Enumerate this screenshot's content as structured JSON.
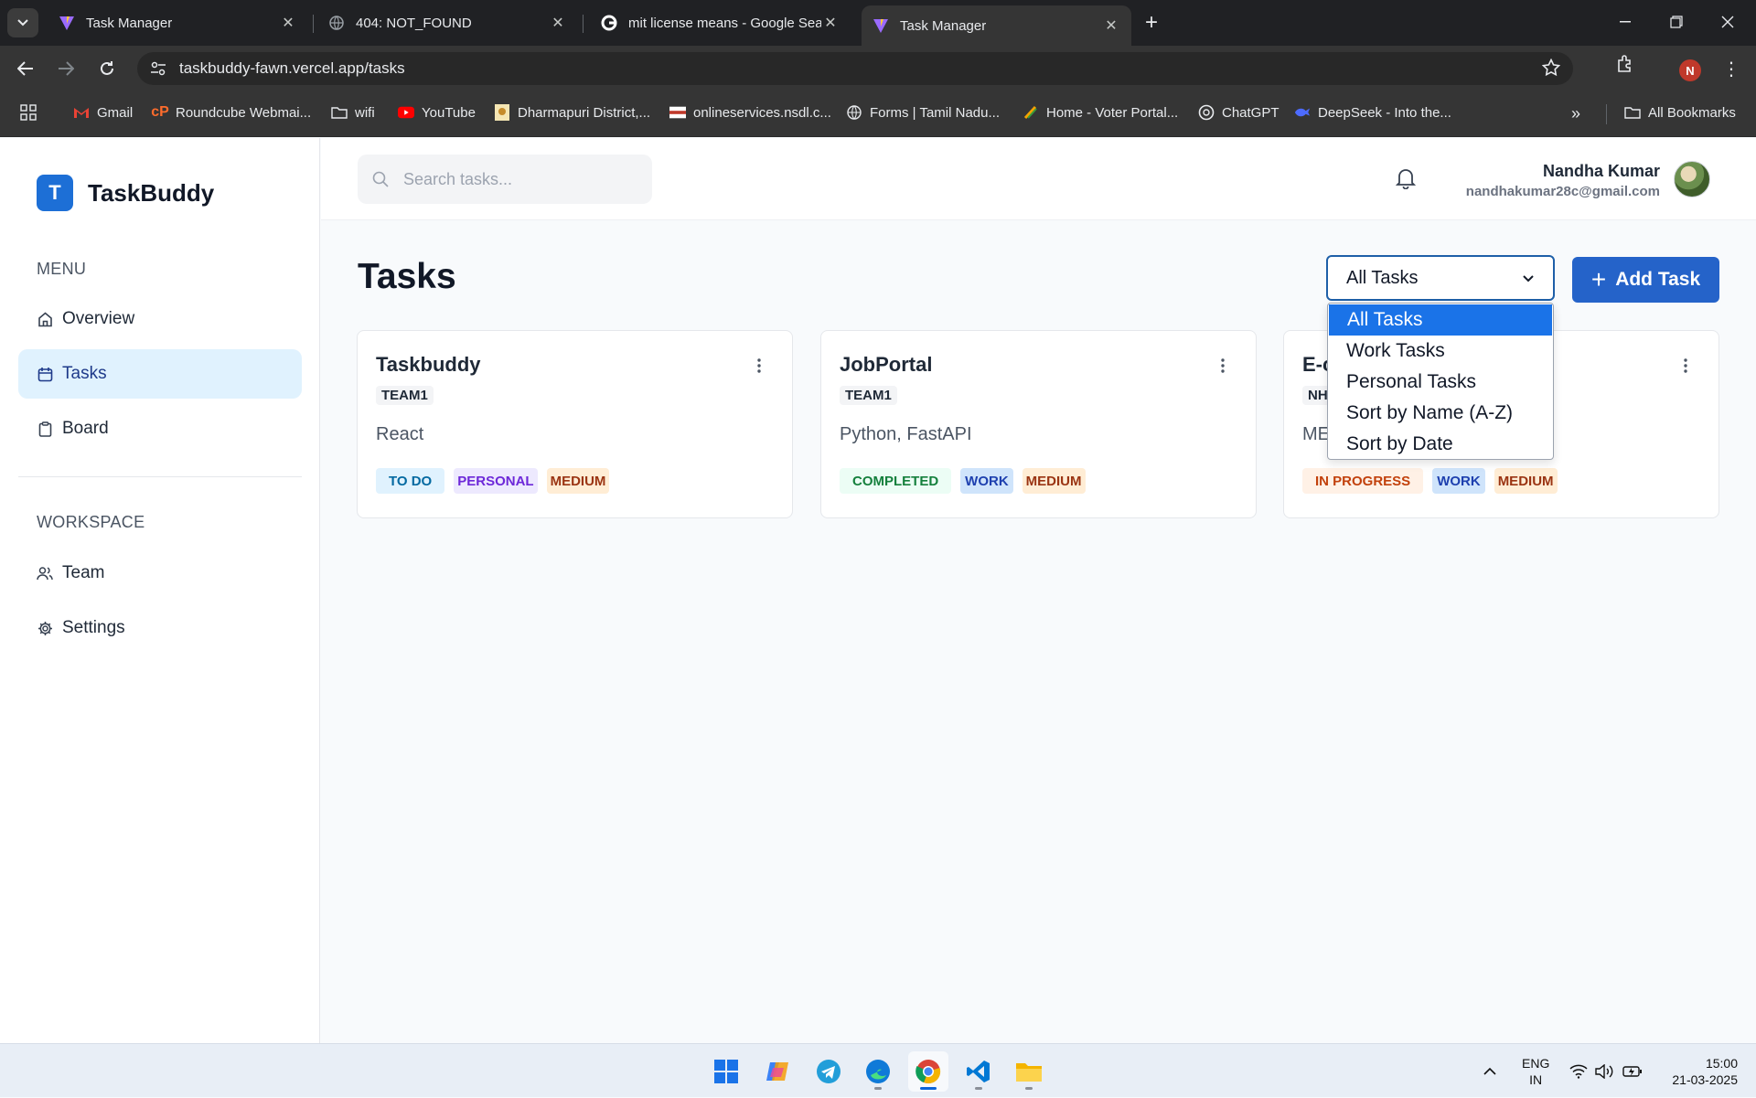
{
  "browser": {
    "tabs": [
      {
        "title": "Task Manager",
        "icon": "vite-icon"
      },
      {
        "title": "404: NOT_FOUND",
        "icon": "globe-icon"
      },
      {
        "title": "mit license means - Google Sea",
        "icon": "google-icon"
      },
      {
        "title": "Task Manager",
        "icon": "vite-icon",
        "active": true
      }
    ],
    "url": "taskbuddy-fawn.vercel.app/tasks",
    "profile_initial": "N",
    "bookmarks": [
      {
        "label": "Gmail",
        "icon": "gmail-icon"
      },
      {
        "label": "Roundcube Webmai...",
        "icon": "cpanel-icon"
      },
      {
        "label": "wifi",
        "icon": "folder-icon"
      },
      {
        "label": "YouTube",
        "icon": "youtube-icon"
      },
      {
        "label": "Dharmapuri District,...",
        "icon": "emblem-icon"
      },
      {
        "label": "onlineservices.nsdl.c...",
        "icon": "nsdl-icon"
      },
      {
        "label": "Forms | Tamil Nadu...",
        "icon": "globe-icon"
      },
      {
        "label": "Home - Voter Portal...",
        "icon": "voter-icon"
      },
      {
        "label": "ChatGPT",
        "icon": "chatgpt-icon"
      },
      {
        "label": "DeepSeek - Into the...",
        "icon": "deepseek-icon"
      }
    ],
    "all_bookmarks": "All Bookmarks"
  },
  "app": {
    "brand": {
      "initial": "T",
      "name": "TaskBuddy"
    },
    "sidebar": {
      "menu_title": "MENU",
      "menu_items": [
        {
          "label": "Overview",
          "icon": "home-icon"
        },
        {
          "label": "Tasks",
          "icon": "calendar-icon",
          "active": true
        },
        {
          "label": "Board",
          "icon": "clipboard-icon"
        }
      ],
      "workspace_title": "WORKSPACE",
      "workspace_items": [
        {
          "label": "Team",
          "icon": "users-icon"
        },
        {
          "label": "Settings",
          "icon": "gear-icon"
        }
      ]
    },
    "header": {
      "search_placeholder": "Search tasks...",
      "user_name": "Nandha Kumar",
      "user_email": "nandhakumar28c@gmail.com"
    },
    "page": {
      "title": "Tasks",
      "filter_value": "All Tasks",
      "add_button": "Add Task",
      "filter_options": [
        "All Tasks",
        "Work Tasks",
        "Personal Tasks",
        "Sort by Name (A-Z)",
        "Sort by Date"
      ]
    },
    "cards": [
      {
        "title": "Taskbuddy",
        "team": "TEAM1",
        "desc": "React",
        "status": "TO DO",
        "category": "PERSONAL",
        "priority": "MEDIUM"
      },
      {
        "title": "JobPortal",
        "team": "TEAM1",
        "desc": "Python, FastAPI",
        "status": "COMPLETED",
        "category": "WORK",
        "priority": "MEDIUM"
      },
      {
        "title": "E-c",
        "team": "NH",
        "desc": "ME",
        "status": "IN PROGRESS",
        "category": "WORK",
        "priority": "MEDIUM"
      }
    ]
  },
  "system": {
    "lang_top": "ENG",
    "lang_bottom": "IN",
    "time": "15:00",
    "date": "21-03-2025"
  },
  "colors": {
    "accent": "#2563c9",
    "dropdown_selected": "#1a73e8",
    "sidebar_active_bg": "#e0f2fe"
  }
}
